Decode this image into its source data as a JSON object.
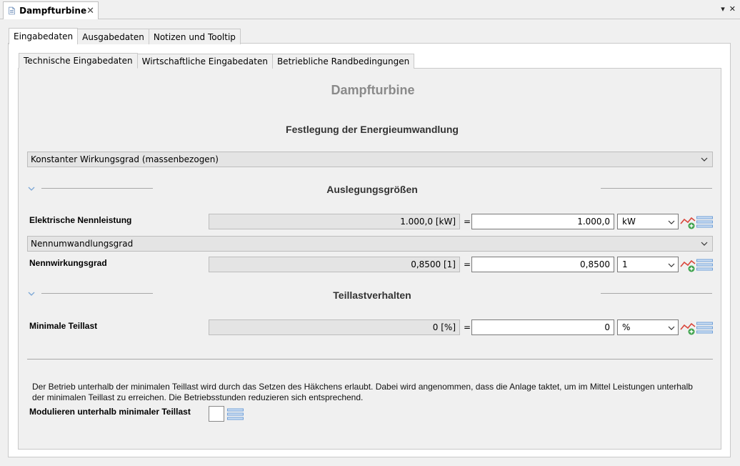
{
  "editor_tab": {
    "title": "Dampfturbine",
    "close_glyph": "✕"
  },
  "window_controls": {
    "menu_glyph": "▾",
    "close_glyph": "✕"
  },
  "outer_tabs": [
    {
      "label": "Eingabedaten",
      "active": true
    },
    {
      "label": "Ausgabedaten",
      "active": false
    },
    {
      "label": "Notizen und Tooltip",
      "active": false
    }
  ],
  "inner_tabs": [
    {
      "label": "Technische Eingabedaten",
      "active": true
    },
    {
      "label": "Wirtschaftliche Eingabedaten",
      "active": false
    },
    {
      "label": "Betriebliche Randbedingungen",
      "active": false
    }
  ],
  "page_title": "Dampfturbine",
  "energy_section": {
    "title": "Festlegung der Energieumwandlung",
    "selected": "Konstanter Wirkungsgrad (massenbezogen)"
  },
  "design_section": {
    "title": "Auslegungsgrößen",
    "nominal_power": {
      "label": "Elektrische Nennleistung",
      "readonly": "1.000,0 [kW]",
      "equals": "=",
      "value": "1.000,0",
      "unit": "kW"
    },
    "conversion_select": "Nennumwandlungsgrad",
    "nominal_efficiency": {
      "label": "Nennwirkungsgrad",
      "readonly": "0,8500 [1]",
      "equals": "=",
      "value": "0,8500",
      "unit": "1"
    }
  },
  "partload_section": {
    "title": "Teillastverhalten",
    "min_partload": {
      "label": "Minimale Teillast",
      "readonly": "0 [%]",
      "equals": "=",
      "value": "0",
      "unit": "%"
    }
  },
  "info": {
    "line1": "Der Betrieb unterhalb der minimalen Teillast wird durch das Setzen des Häkchens erlaubt. Dabei wird angenommen, dass die Anlage taktet, um im Mittel Leistungen unterhalb",
    "line2": "der minimalen Teillast zu erreichen. Die Betriebsstunden reduzieren sich entsprechend."
  },
  "modulate": {
    "label": "Modulieren unterhalb minimaler Teillast",
    "checked": false
  },
  "colors": {
    "title_gray": "#8a8a8a",
    "panel": "#f0f0f0",
    "field_readonly": "#e4e4e4",
    "trend_red": "#d9463b",
    "trend_green": "#3fa34d",
    "list_blue": "#6f9fd8"
  }
}
